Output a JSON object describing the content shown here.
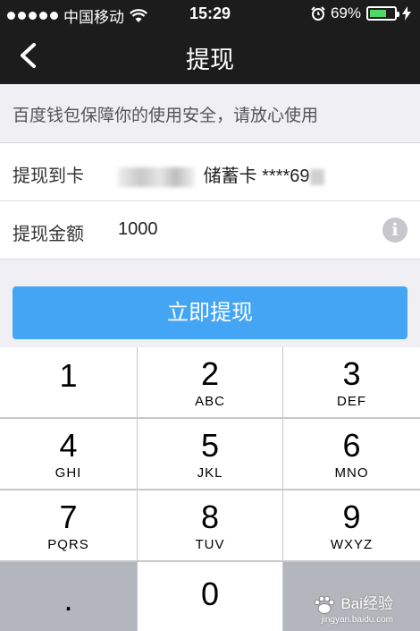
{
  "status_bar": {
    "carrier": "中国移动",
    "time": "15:29",
    "battery_percent_label": "69%",
    "battery_level": 0.69,
    "battery_color": "#4cd964"
  },
  "nav": {
    "title": "提现",
    "back_icon": "chevron-left-icon"
  },
  "notice": "百度钱包保障你的使用安全，请放心使用",
  "form": {
    "card_label": "提现到卡",
    "card_type": "储蓄卡",
    "card_number_masked": "****69",
    "amount_label": "提现金额",
    "amount_value": "1000",
    "info_icon": "info-icon"
  },
  "withdraw_button": {
    "label": "立即提现",
    "color": "#45a5f5"
  },
  "keypad": {
    "keys": [
      {
        "num": "1",
        "letters": ""
      },
      {
        "num": "2",
        "letters": "ABC"
      },
      {
        "num": "3",
        "letters": "DEF"
      },
      {
        "num": "4",
        "letters": "GHI"
      },
      {
        "num": "5",
        "letters": "JKL"
      },
      {
        "num": "6",
        "letters": "MNO"
      },
      {
        "num": "7",
        "letters": "PQRS"
      },
      {
        "num": "8",
        "letters": "TUV"
      },
      {
        "num": "9",
        "letters": "WXYZ"
      },
      {
        "num": ".",
        "letters": ""
      },
      {
        "num": "0",
        "letters": ""
      }
    ]
  },
  "watermark": {
    "text": "Bai经验",
    "sub": "jingyan.baidu.com"
  }
}
